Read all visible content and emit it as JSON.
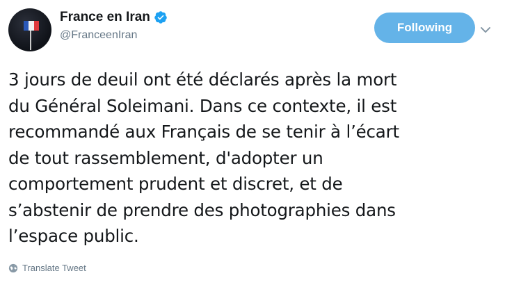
{
  "account": {
    "display_name": "France en Iran",
    "handle": "@FranceenIran",
    "verified": true
  },
  "actions": {
    "follow_label": "Following"
  },
  "tweet": {
    "text": "3 jours de deuil ont été déclarés après la mort\ndu Général Soleimani. Dans ce contexte, il est\nrecommandé aux Français de se tenir à l’écart\nde tout rassemblement, d'adopter un\ncomportement prudent et discret, et de\ns’abstenir de prendre des photographies dans\nl’espace public."
  },
  "footer": {
    "translate_label": "Translate Tweet"
  },
  "icons": {
    "verified": "verified-badge-icon",
    "chevron": "chevron-down-icon",
    "translate": "globe-icon"
  },
  "colors": {
    "follow_button": "#64b3e8",
    "verified": "#1da1f2",
    "muted_text": "#657786"
  }
}
